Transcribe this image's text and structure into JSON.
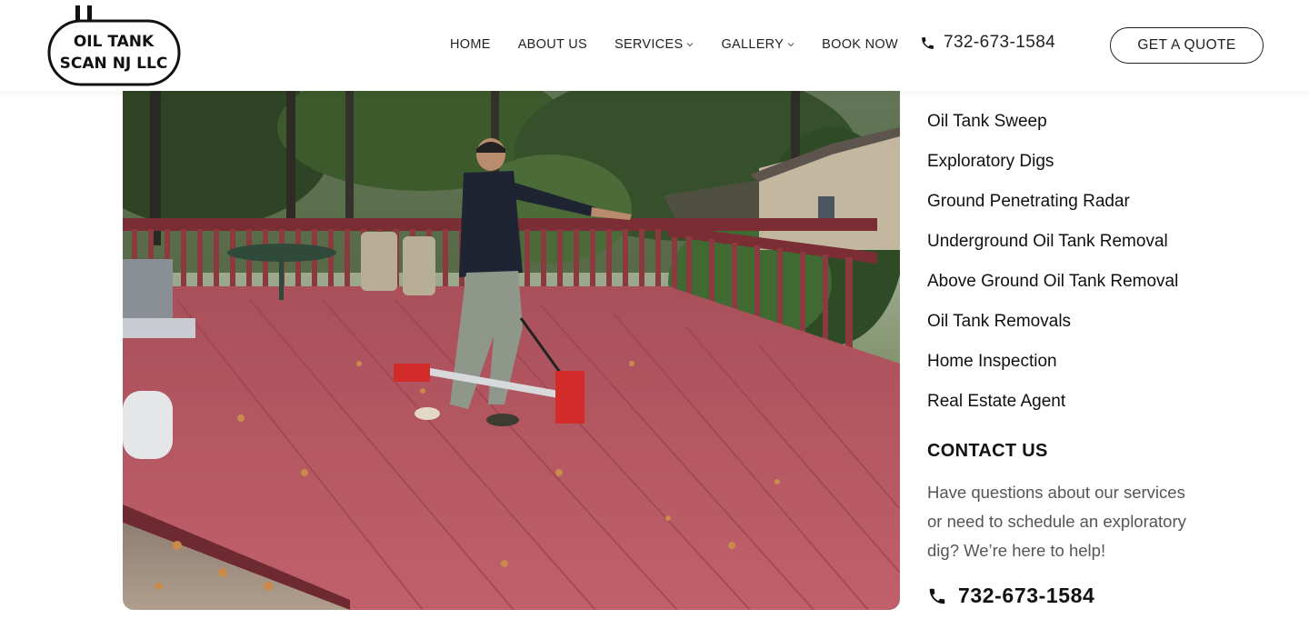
{
  "header": {
    "logo": {
      "line1": "OIL TANK",
      "line2": "SCAN NJ LLC"
    },
    "nav": [
      {
        "label": "HOME",
        "has_dropdown": false
      },
      {
        "label": "ABOUT US",
        "has_dropdown": false
      },
      {
        "label": "SERVICES",
        "has_dropdown": true
      },
      {
        "label": "GALLERY",
        "has_dropdown": true
      },
      {
        "label": "BOOK NOW",
        "has_dropdown": false
      }
    ],
    "phone": "732-673-1584",
    "phone_icon": "phone-icon",
    "cta_label": "GET A QUOTE"
  },
  "photo": {
    "subject": "technician-scanning-deck-with-ground-penetrating-radar"
  },
  "sidebar": {
    "services": [
      "Oil Tank Sweep",
      "Exploratory Digs",
      "Ground Penetrating Radar",
      "Underground Oil Tank Removal",
      "Above Ground Oil Tank Removal",
      "Oil Tank Removals",
      "Home Inspection",
      "Real Estate Agent"
    ],
    "contact_title": "CONTACT US",
    "contact_text": "Have questions about our services or need to schedule an exploratory dig? We’re here to help!",
    "contact_phone": "732-673-1584",
    "contact_phone_icon": "phone-icon"
  },
  "colors": {
    "text_dark": "#111111",
    "text_muted": "#555555",
    "deck_red": "#b9565c",
    "background": "#ffffff"
  }
}
